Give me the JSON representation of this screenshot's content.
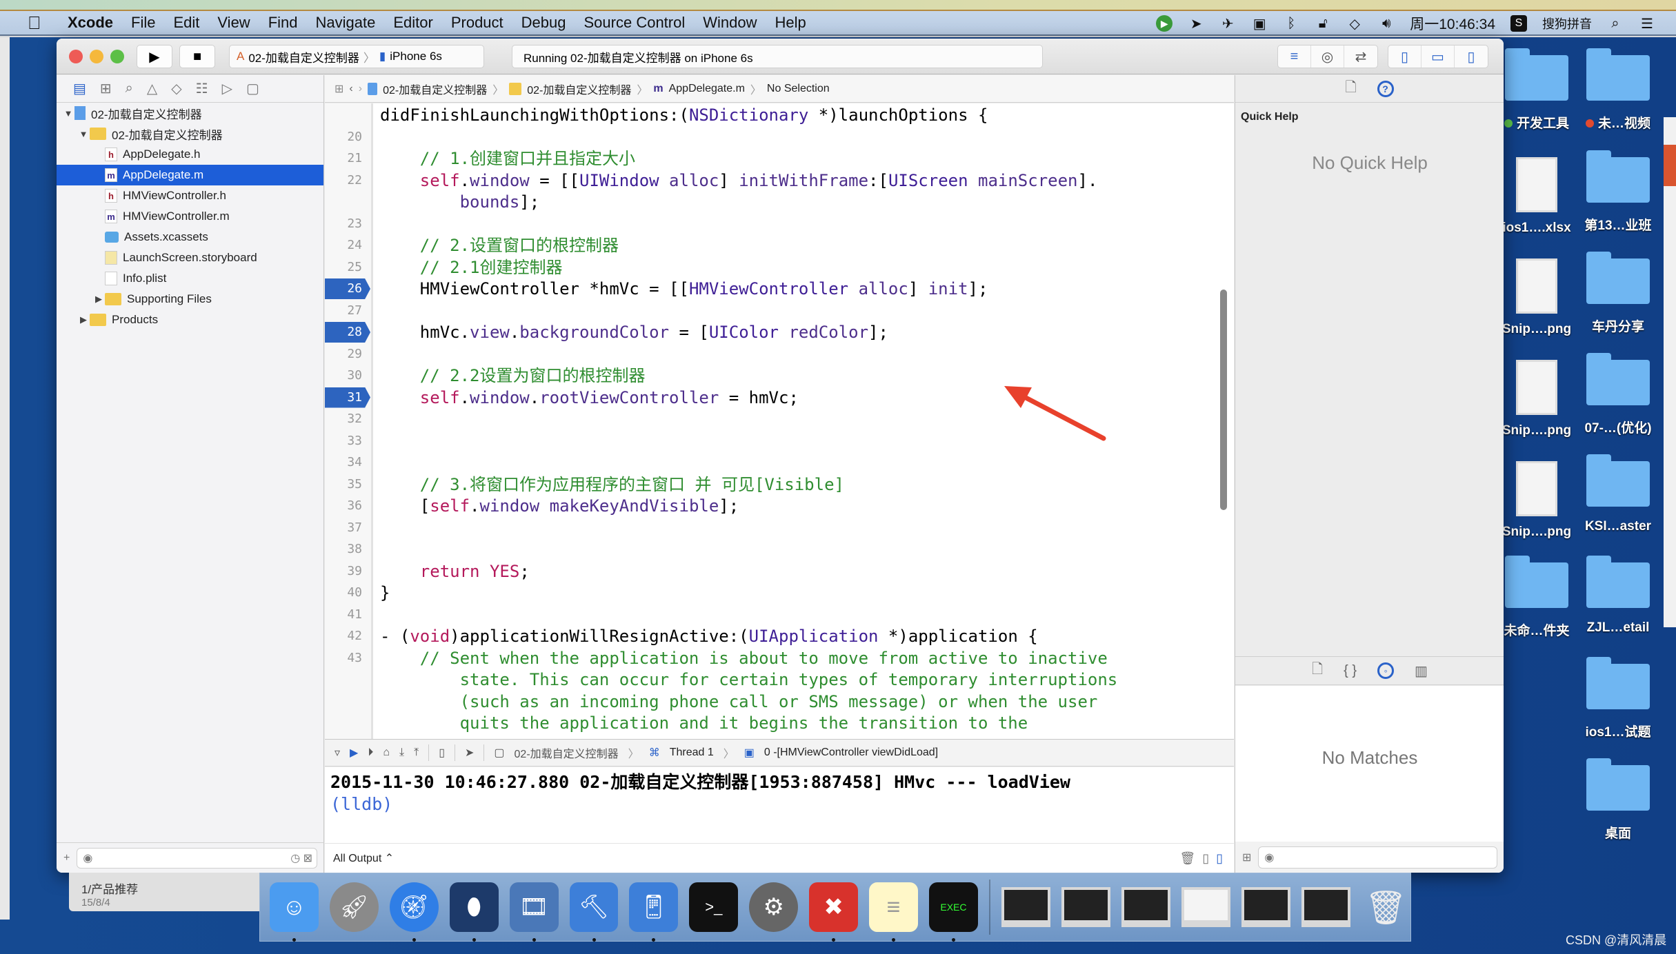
{
  "menubar": {
    "app_name": "Xcode",
    "items": [
      "File",
      "Edit",
      "View",
      "Find",
      "Navigate",
      "Editor",
      "Product",
      "Debug",
      "Source Control",
      "Window",
      "Help"
    ],
    "clock": "周一10:46:34",
    "input_method": "搜狗拼音"
  },
  "toolbar": {
    "scheme_name": "02-加载自定义控制器",
    "device": "iPhone 6s",
    "activity_status": "Running 02-加载自定义控制器 on iPhone 6s"
  },
  "navigator": {
    "tree": [
      {
        "label": "02-加载自定义控制器",
        "kind": "project",
        "depth": 0,
        "expanded": true
      },
      {
        "label": "02-加载自定义控制器",
        "kind": "group",
        "depth": 1,
        "expanded": true
      },
      {
        "label": "AppDelegate.h",
        "kind": "h",
        "depth": 2
      },
      {
        "label": "AppDelegate.m",
        "kind": "m",
        "depth": 2,
        "selected": true
      },
      {
        "label": "HMViewController.h",
        "kind": "h",
        "depth": 2
      },
      {
        "label": "HMViewController.m",
        "kind": "m",
        "depth": 2
      },
      {
        "label": "Assets.xcassets",
        "kind": "assets",
        "depth": 2
      },
      {
        "label": "LaunchScreen.storyboard",
        "kind": "storyboard",
        "depth": 2
      },
      {
        "label": "Info.plist",
        "kind": "plist",
        "depth": 2
      },
      {
        "label": "Supporting Files",
        "kind": "group",
        "depth": 2,
        "expanded": false
      },
      {
        "label": "Products",
        "kind": "group",
        "depth": 1,
        "expanded": false
      }
    ]
  },
  "jumpbar": {
    "crumbs": [
      "02-加载自定义控制器",
      "02-加载自定义控制器",
      "AppDelegate.m",
      "No Selection"
    ]
  },
  "editor": {
    "lines": [
      {
        "n": "",
        "html": "didFinishLaunchingWithOptions:(<span class='t'>NSDictionary</span> *)launchOptions {"
      },
      {
        "n": "20",
        "html": ""
      },
      {
        "n": "21",
        "html": "    <span class='c'>// 1.创建窗口并且指定大小</span>"
      },
      {
        "n": "22",
        "html": "    <span class='k'>self</span>.<span class='p'>window</span> = [[<span class='t'>UIWindow</span> <span class='p'>alloc</span>] <span class='p'>initWithFrame</span>:[<span class='t'>UIScreen</span> <span class='p'>mainScreen</span>]."
      },
      {
        "n": "",
        "html": "        <span class='p'>bounds</span>];"
      },
      {
        "n": "23",
        "html": ""
      },
      {
        "n": "24",
        "html": "    <span class='c'>// 2.设置窗口的根控制器</span>"
      },
      {
        "n": "25",
        "html": "    <span class='c'>// 2.1创建控制器</span>"
      },
      {
        "n": "26",
        "bp": true,
        "html": "    HMViewController *hmVc = [[<span class='t'>HMViewController</span> <span class='p'>alloc</span>] <span class='p'>init</span>];"
      },
      {
        "n": "27",
        "html": ""
      },
      {
        "n": "28",
        "bp": true,
        "html": "    hmVc.<span class='p'>view</span>.<span class='p'>backgroundColor</span> = [<span class='t'>UIColor</span> <span class='p'>redColor</span>];"
      },
      {
        "n": "29",
        "html": ""
      },
      {
        "n": "30",
        "html": "    <span class='c'>// 2.2设置为窗口的根控制器</span>"
      },
      {
        "n": "31",
        "bp": true,
        "html": "    <span class='k'>self</span>.<span class='p'>window</span>.<span class='p'>rootViewController</span> = hmVc;"
      },
      {
        "n": "32",
        "html": ""
      },
      {
        "n": "33",
        "html": ""
      },
      {
        "n": "34",
        "html": ""
      },
      {
        "n": "35",
        "html": "    <span class='c'>// 3.将窗口作为应用程序的主窗口 并 可见[Visible]</span>"
      },
      {
        "n": "36",
        "html": "    [<span class='k'>self</span>.<span class='p'>window</span> <span class='p'>makeKeyAndVisible</span>];"
      },
      {
        "n": "37",
        "html": ""
      },
      {
        "n": "38",
        "html": ""
      },
      {
        "n": "39",
        "html": "    <span class='k'>return</span> <span class='k'>YES</span>;"
      },
      {
        "n": "40",
        "html": "}"
      },
      {
        "n": "41",
        "html": ""
      },
      {
        "n": "42",
        "html": "- (<span class='k'>void</span>)applicationWillResignActive:(<span class='t'>UIApplication</span> *)application {"
      },
      {
        "n": "43",
        "html": "    <span class='c'>// Sent when the application is about to move from active to inactive</span>"
      },
      {
        "n": "",
        "html": "        <span class='c'>state. This can occur for certain types of temporary interruptions</span>"
      },
      {
        "n": "",
        "html": "        <span class='c'>(such as an incoming phone call or SMS message) or when the user</span>"
      },
      {
        "n": "",
        "html": "        <span class='c'>quits the application and it begins the transition to the</span>"
      }
    ]
  },
  "debugbar": {
    "target": "02-加载自定义控制器",
    "thread": "Thread 1",
    "frame": "0 -[HMViewController viewDidLoad]"
  },
  "console": {
    "log_line": "2015-11-30 10:46:27.880 02-加载自定义控制器[1953:887458] HMvc --- loadView",
    "prompt": "(lldb)",
    "output_filter": "All Output ⌃"
  },
  "inspector": {
    "section_title": "Quick Help",
    "empty_text": "No Quick Help",
    "library_empty_text": "No Matches"
  },
  "desktop": {
    "icons": [
      {
        "label": "开发工具",
        "kind": "folder",
        "tag": "#5cc04a"
      },
      {
        "label": "未…视频",
        "kind": "folder",
        "tag": "#e24a2f"
      },
      {
        "label": "ios1….xlsx",
        "kind": "doc"
      },
      {
        "label": "第13…业班",
        "kind": "folder"
      },
      {
        "label": "Snip….png",
        "kind": "doc"
      },
      {
        "label": "车丹分享",
        "kind": "folder"
      },
      {
        "label": "Snip….png",
        "kind": "doc"
      },
      {
        "label": "07-…(优化)",
        "kind": "folder"
      },
      {
        "label": "Snip….png",
        "kind": "doc"
      },
      {
        "label": "KSI…aster",
        "kind": "folder"
      },
      {
        "label": "未命…件夹",
        "kind": "folder"
      },
      {
        "label": "ZJL…etail",
        "kind": "folder"
      },
      {
        "label": "ios1…试题",
        "kind": "folder"
      },
      {
        "label": "桌面",
        "kind": "folder"
      }
    ]
  },
  "notification": {
    "title": "1/产品推荐",
    "date": "15/8/4"
  },
  "dock": {
    "apps": [
      "Finder",
      "Launchpad",
      "Safari",
      "Mouse",
      "Photo Slideshow",
      "Xcode",
      "Simulator",
      "Terminal",
      "System Preferences",
      "XMind",
      "Notes",
      "Console"
    ]
  },
  "watermark": "CSDN @清风清晨"
}
